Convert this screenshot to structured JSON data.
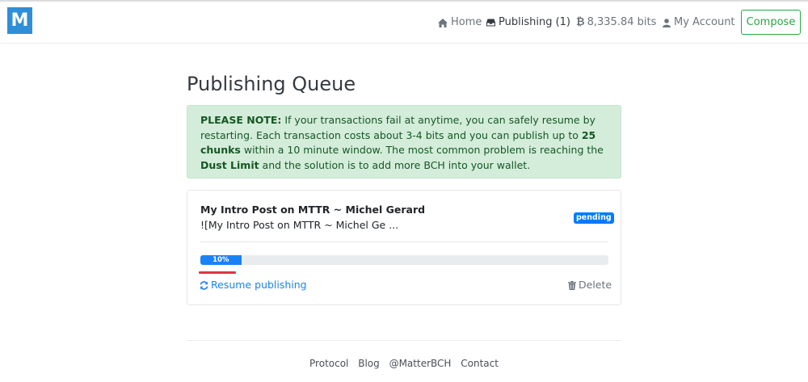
{
  "nav": {
    "brand": "M",
    "home": "Home",
    "publishing": "Publishing (1)",
    "balance": "8,335.84 bits",
    "account": "My Account",
    "compose": "Compose"
  },
  "page": {
    "title": "Publishing Queue"
  },
  "notice": {
    "label": "PLEASE NOTE:",
    "text1": " If your transactions fail at anytime, you can safely resume by restarting. Each transaction costs about 3-4 bits and you can publish up to ",
    "chunks": "25 chunks",
    "text2": " within a 10 minute window. The most common problem is reaching the ",
    "dust": "Dust Limit",
    "text3": " and the solution is to add more BCH into your wallet."
  },
  "queue": {
    "title": "My Intro Post on MTTR ~ Michel Gerard",
    "excerpt": "![My Intro Post on MTTR ~ Michel Ge ...",
    "status": "pending",
    "progress_label": "10%",
    "progress_value": 0.1,
    "resume": "Resume publishing",
    "delete": "Delete"
  },
  "footer": {
    "links": [
      "Protocol",
      "Blog",
      "@MatterBCH",
      "Contact"
    ]
  }
}
